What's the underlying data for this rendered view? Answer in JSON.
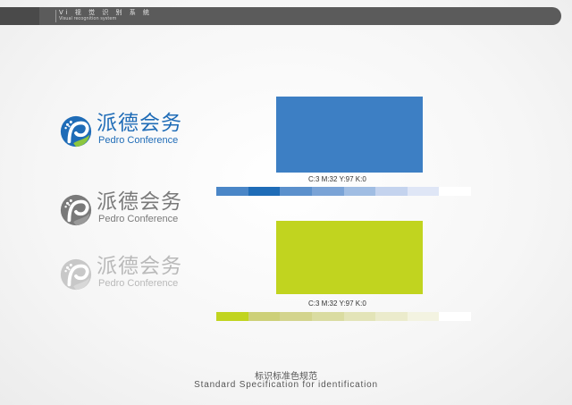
{
  "header": {
    "title": "Vi 视 觉 识 别 系 统",
    "subtitle": "Visual recognition system"
  },
  "logos": [
    {
      "variant": "full-color",
      "cn": "派德会务",
      "en": "Pedro Conference",
      "color": "#1f6cb7",
      "accent": "#8cc63f"
    },
    {
      "variant": "grayscale",
      "cn": "派德会务",
      "en": "Pedro Conference",
      "color": "#7a7a7a",
      "accent": "#7a7a7a"
    },
    {
      "variant": "light-gray",
      "cn": "派德会务",
      "en": "Pedro Conference",
      "color": "#c0c0c0",
      "accent": "#c0c0c0"
    }
  ],
  "swatches": [
    {
      "name": "blue",
      "color": "#3d7fc4",
      "cmyk": "C:3   M:32   Y:97   K:0",
      "tints": [
        "#4a86c7",
        "#1f6cb7",
        "#5b90cc",
        "#7aa3d6",
        "#a0bde3",
        "#c4d3ee",
        "#dfe6f6",
        "#ffffff"
      ]
    },
    {
      "name": "green",
      "color": "#c1d41f",
      "cmyk": "C:3   M:32   Y:97   K:0",
      "tints": [
        "#c1d41f",
        "#cdd078",
        "#d3d48d",
        "#dadca1",
        "#e3e4b8",
        "#ebebcc",
        "#f3f3e1",
        "#ffffff"
      ]
    }
  ],
  "caption": {
    "cn": "标识标准色规范",
    "en": "Standard Specification for identification"
  }
}
